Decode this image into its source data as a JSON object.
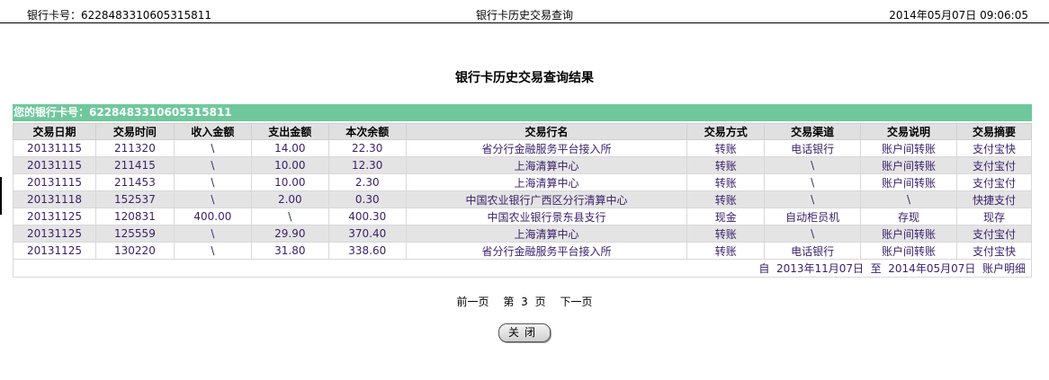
{
  "header": {
    "card_label": "银行卡号：6228483310605315811",
    "title": "银行卡历史交易查询",
    "datetime": "2014年05月07日 09:06:05"
  },
  "main": {
    "title": "银行卡历史交易查询结果",
    "card_banner": "您的银行卡号：6228483310605315811"
  },
  "table": {
    "columns": [
      "交易日期",
      "交易时间",
      "收入金额",
      "支出金额",
      "本次余额",
      "交易行名",
      "交易方式",
      "交易渠道",
      "交易说明",
      "交易摘要"
    ],
    "rows": [
      [
        "20131115",
        "211320",
        "\\",
        "14.00",
        "22.30",
        "省分行金融服务平台接入所",
        "转账",
        "电话银行",
        "账户间转账",
        "支付宝快"
      ],
      [
        "20131115",
        "211415",
        "\\",
        "10.00",
        "12.30",
        "上海清算中心",
        "转账",
        "\\",
        "账户间转账",
        "支付宝付"
      ],
      [
        "20131115",
        "211453",
        "\\",
        "10.00",
        "2.30",
        "上海清算中心",
        "转账",
        "\\",
        "账户间转账",
        "支付宝付"
      ],
      [
        "20131118",
        "152537",
        "\\",
        "2.00",
        "0.30",
        "中国农业银行广西区分行清算中心",
        "转账",
        "\\",
        "\\",
        "快捷支付"
      ],
      [
        "20131125",
        "120831",
        "400.00",
        "\\",
        "400.30",
        "中国农业银行景东县支行",
        "现金",
        "自动柜员机",
        "存现",
        "现存"
      ],
      [
        "20131125",
        "125559",
        "\\",
        "29.90",
        "370.40",
        "上海清算中心",
        "转账",
        "\\",
        "账户间转账",
        "支付宝付"
      ],
      [
        "20131125",
        "130220",
        "\\",
        "31.80",
        "338.60",
        "省分行金融服务平台接入所",
        "转账",
        "电话银行",
        "账户间转账",
        "支付宝快"
      ]
    ],
    "footer": "自  2013年11月07日  至  2014年05月07日  账户明细"
  },
  "pager": {
    "prev": "前一页",
    "page_prefix": "第",
    "page_number": "3",
    "page_suffix": "页",
    "next": "下一页"
  },
  "close_button": "关闭"
}
